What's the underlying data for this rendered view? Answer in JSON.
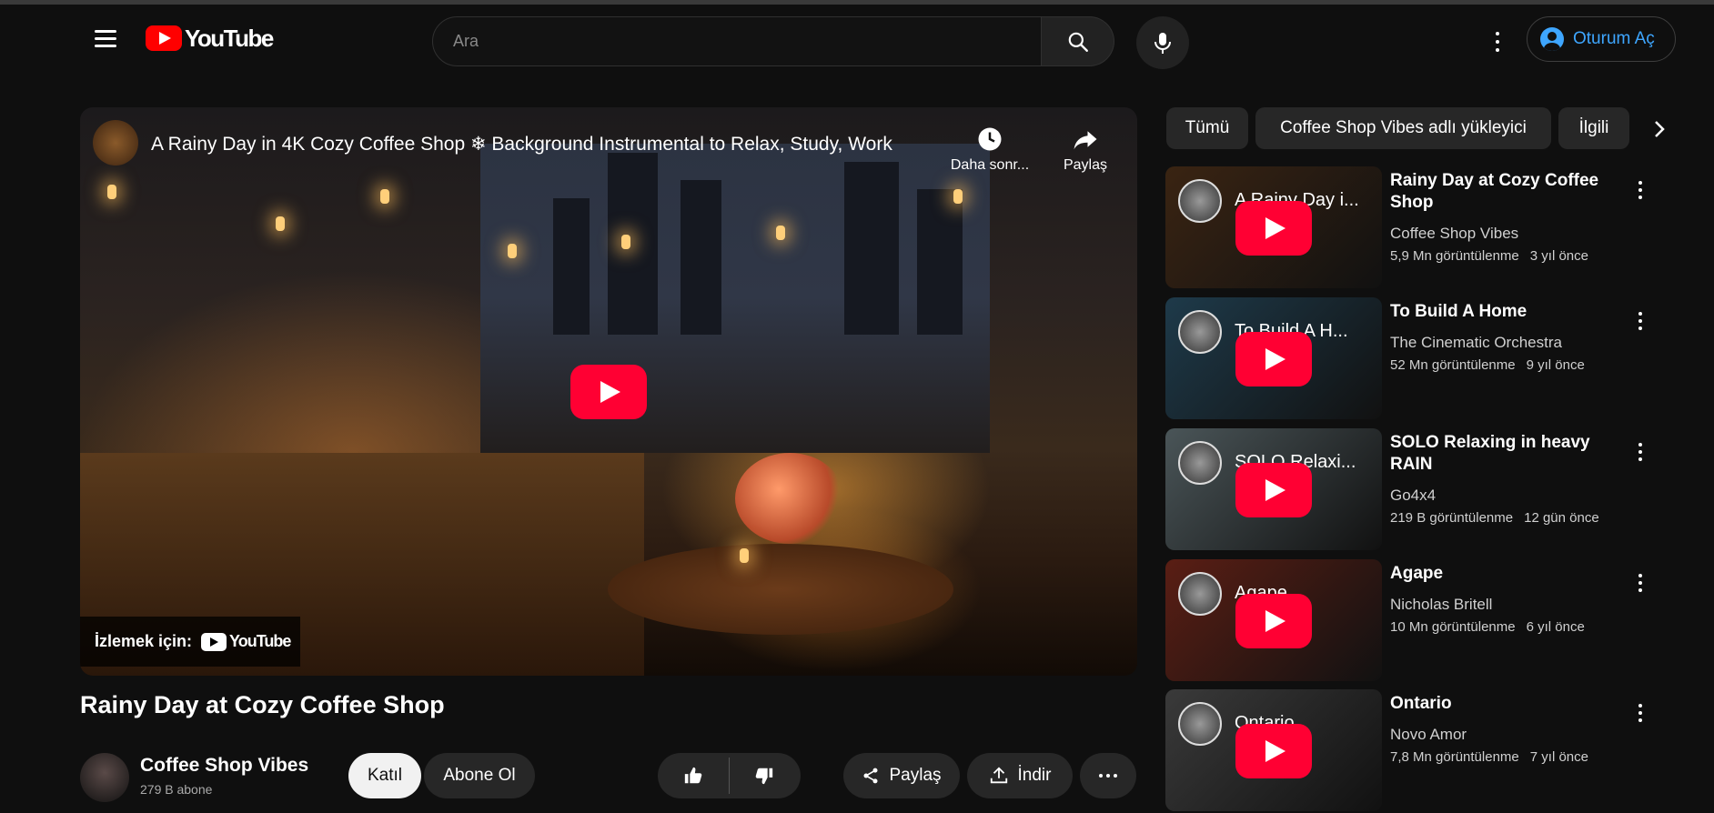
{
  "header": {
    "logo_text": "YouTube",
    "search_placeholder": "Ara",
    "signin_label": "Oturum Aç"
  },
  "player": {
    "overlay_title": "A Rainy Day in 4K Cozy Coffee Shop ❄ Background Instrumental to Relax, Study, Work",
    "watch_later_label": "Daha sonr...",
    "share_label": "Paylaş",
    "watch_on_label": "İzlemek için:",
    "watch_on_logo": "YouTube"
  },
  "video": {
    "title": "Rainy Day at Cozy Coffee Shop",
    "channel": "Coffee Shop Vibes",
    "subscribers": "279 B abone",
    "join_label": "Katıl",
    "subscribe_label": "Abone Ol",
    "share_label": "Paylaş",
    "download_label": "İndir"
  },
  "chips": [
    "Tümü",
    "Coffee Shop Vibes adlı yükleyici",
    "İlgili"
  ],
  "recommendations": [
    {
      "thumb_text": "A Rainy Day i...",
      "title": "Rainy Day at Cozy Coffee Shop",
      "channel": "Coffee Shop Vibes",
      "views": "5,9 Mn görüntülenme",
      "age": "3 yıl önce",
      "thumb_color": "#3a2412"
    },
    {
      "thumb_text": "To Build A H...",
      "title": "To Build A Home",
      "channel": "The Cinematic Orchestra",
      "views": "52 Mn görüntülenme",
      "age": "9 yıl önce",
      "thumb_color": "#1e3a4a"
    },
    {
      "thumb_text": "SOLO Relaxi...",
      "title": "SOLO Relaxing in heavy RAIN",
      "channel": "Go4x4",
      "views": "219 B görüntülenme",
      "age": "12 gün önce",
      "thumb_color": "#4a5558"
    },
    {
      "thumb_text": "Agape",
      "title": "Agape",
      "channel": "Nicholas Britell",
      "views": "10 Mn görüntülenme",
      "age": "6 yıl önce",
      "thumb_color": "#5a1e14"
    },
    {
      "thumb_text": "Ontario",
      "title": "Ontario",
      "channel": "Novo Amor",
      "views": "7,8 Mn görüntülenme",
      "age": "7 yıl önce",
      "thumb_color": "#3a3a3a"
    }
  ],
  "colors": {
    "background": "#0f0f0f",
    "accent_blue": "#3ea6ff",
    "play_red": "#ff0033",
    "pill": "#272727"
  },
  "icons": [
    "menu-icon",
    "search-icon",
    "mic-icon",
    "more-vert-icon",
    "account-icon",
    "clock-icon",
    "share-icon",
    "thumbs-up-icon",
    "thumbs-down-icon",
    "download-icon",
    "chevron-right-icon"
  ]
}
